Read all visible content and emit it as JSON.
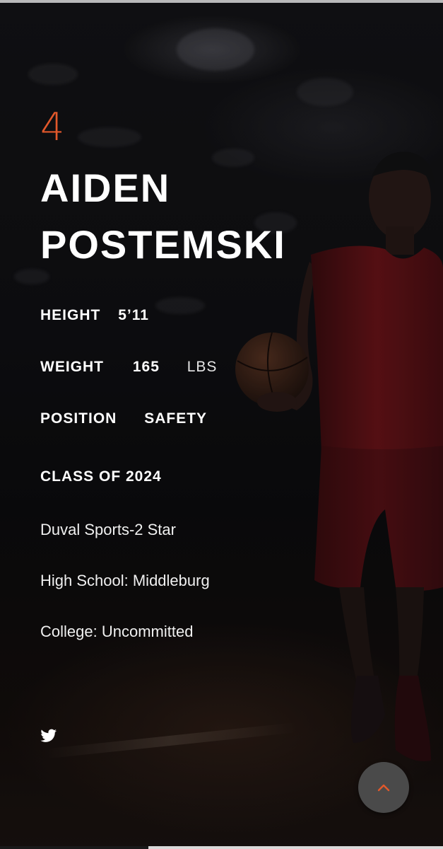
{
  "player": {
    "number": "4",
    "first_name": "AIDEN",
    "last_name": "POSTEMSKI"
  },
  "stats": {
    "height_label": "HEIGHT",
    "height_value": "5’11",
    "weight_label": "WEIGHT",
    "weight_value": "165",
    "weight_unit": "LBS",
    "position_label": "POSITION",
    "position_value": "SAFETY",
    "class_label": "CLASS OF 2024"
  },
  "info": {
    "rating": "Duval Sports-2 Star",
    "high_school": "High School: Middleburg",
    "college": "College: Uncommitted"
  },
  "icons": {
    "social": "twitter-icon",
    "back_to_top": "chevron-up-icon"
  },
  "colors": {
    "accent": "#e2582b",
    "text": "#ffffff",
    "button_bg": "#4a4a4a"
  }
}
